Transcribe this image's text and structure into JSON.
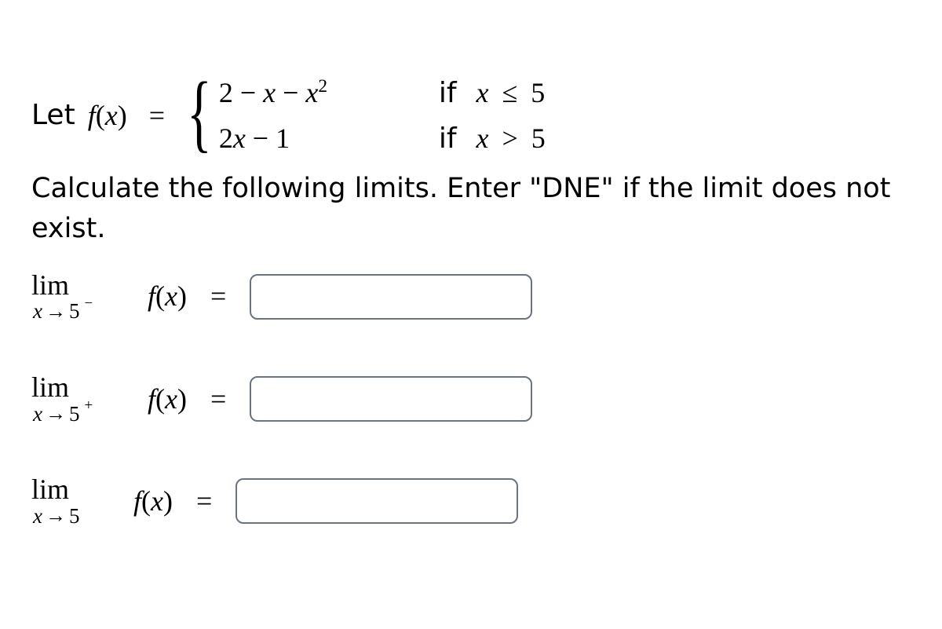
{
  "definition": {
    "let_word": "Let",
    "func": "f",
    "var": "x",
    "equals": "=",
    "case1_expr_parts": [
      "2",
      " − ",
      "x",
      " − ",
      "x"
    ],
    "case1_expr_sup": "2",
    "case1_cond_prefix": "if",
    "case1_cond_var": "x",
    "case1_cond_rel": "≤",
    "case1_cond_val": "5",
    "case2_expr_parts": [
      "2",
      "x",
      " − ",
      "1"
    ],
    "case2_cond_prefix": "if",
    "case2_cond_var": "x",
    "case2_cond_rel": ">",
    "case2_cond_val": "5"
  },
  "instruction": "Calculate the following limits. Enter \"DNE\" if the limit does not exist.",
  "limits": [
    {
      "lim_word": "lim",
      "sub_var": "x",
      "arrow": "→",
      "sub_val": "5",
      "side": "−",
      "func": "f",
      "var": "x",
      "equals": "="
    },
    {
      "lim_word": "lim",
      "sub_var": "x",
      "arrow": "→",
      "sub_val": "5",
      "side": "+",
      "func": "f",
      "var": "x",
      "equals": "="
    },
    {
      "lim_word": "lim",
      "sub_var": "x",
      "arrow": "→",
      "sub_val": "5",
      "side": "",
      "func": "f",
      "var": "x",
      "equals": "="
    }
  ]
}
